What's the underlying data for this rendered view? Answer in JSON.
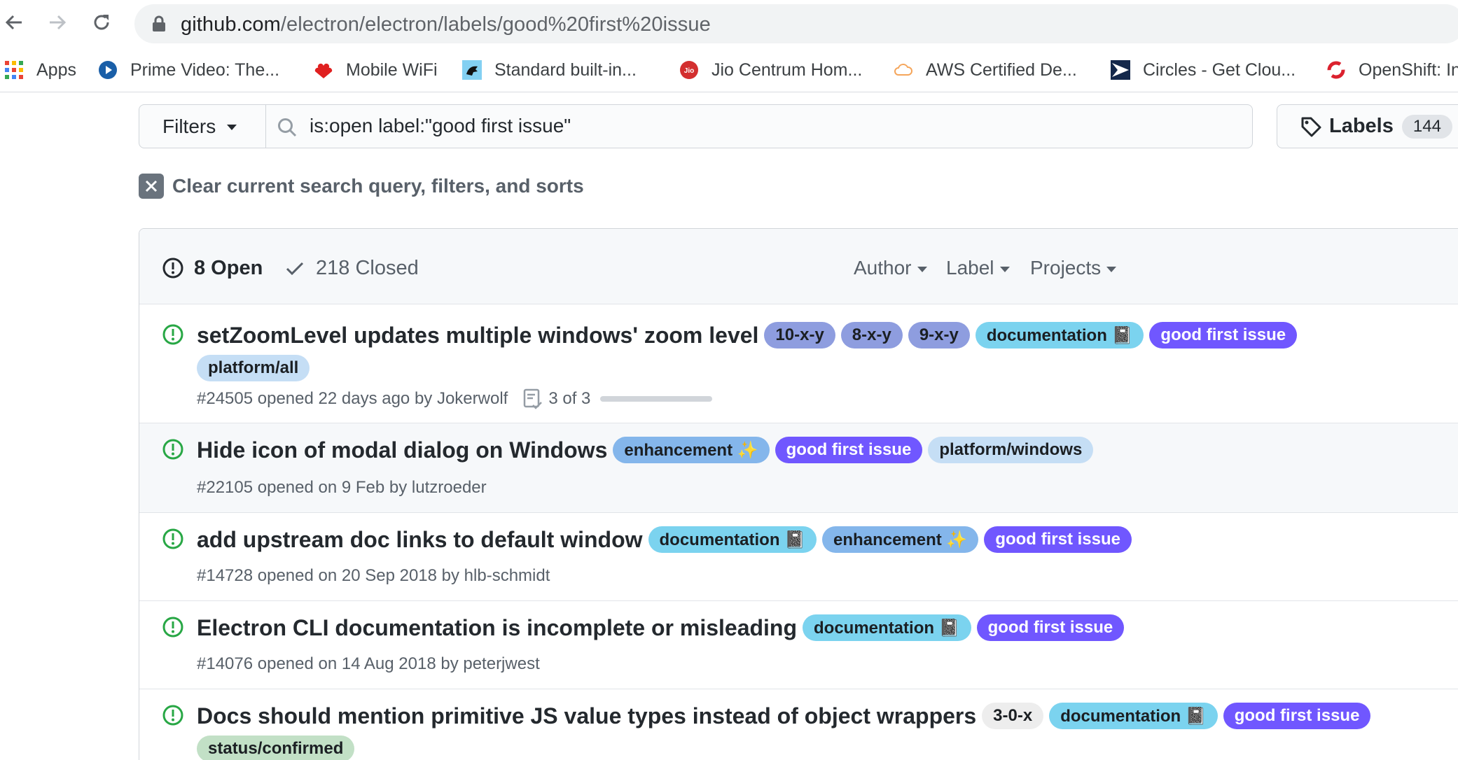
{
  "browser": {
    "url_host": "github.com",
    "url_path": "/electron/electron/labels/good%20first%20issue",
    "bookmarks": [
      {
        "label": "Apps",
        "icon": "apps-grid-icon"
      },
      {
        "label": "Prime Video: The...",
        "icon": "prime-video-icon"
      },
      {
        "label": "Mobile WiFi",
        "icon": "huawei-icon"
      },
      {
        "label": "Standard built-in...",
        "icon": "mdn-icon"
      },
      {
        "label": "Jio Centrum Hom...",
        "icon": "jio-icon"
      },
      {
        "label": "AWS Certified De...",
        "icon": "cloud-icon"
      },
      {
        "label": "Circles - Get Clou...",
        "icon": "circles-icon"
      },
      {
        "label": "OpenShift: In",
        "icon": "openshift-icon"
      }
    ]
  },
  "toolbar": {
    "filters_label": "Filters",
    "search_value": "is:open label:\"good first issue\"",
    "labels_label": "Labels",
    "labels_count": "144"
  },
  "clear_query_label": "Clear current search query, filters, and sorts",
  "header": {
    "open_label": "8 Open",
    "closed_label": "218 Closed",
    "filters": [
      "Author",
      "Label",
      "Projects"
    ]
  },
  "colors": {
    "open_green": "#28a745",
    "label_version": "#8e9ddf",
    "label_documentation": "#7bd3ef",
    "label_good_first_issue": "#7057ff",
    "label_platform": "#c5def5",
    "label_enhancement": "#84b6eb",
    "label_grey": "#ededed",
    "label_confirmed": "#c2e0c6"
  },
  "issues": [
    {
      "title": "setZoomLevel updates multiple windows' zoom level",
      "labels": [
        "10-x-y",
        "8-x-y",
        "9-x-y",
        "documentation 📓",
        "good first issue"
      ],
      "labels_wrap": [
        "platform/all"
      ],
      "meta": "#24505 opened 22 days ago by Jokerwolf",
      "tasks": "3 of 3",
      "tasks_progress": 1.0
    },
    {
      "title": "Hide icon of modal dialog on Windows",
      "labels": [
        "enhancement ✨",
        "good first issue",
        "platform/windows"
      ],
      "meta": "#22105 opened on 9 Feb by lutzroeder"
    },
    {
      "title": "add upstream doc links to default window",
      "labels": [
        "documentation 📓",
        "enhancement ✨",
        "good first issue"
      ],
      "meta": "#14728 opened on 20 Sep 2018 by hlb-schmidt"
    },
    {
      "title": "Electron CLI documentation is incomplete or misleading",
      "labels": [
        "documentation 📓",
        "good first issue"
      ],
      "meta": "#14076 opened on 14 Aug 2018 by peterjwest"
    },
    {
      "title": "Docs should mention primitive JS value types instead of object wrappers",
      "labels": [
        "3-0-x",
        "documentation 📓",
        "good first issue"
      ],
      "labels_wrap": [
        "status/confirmed"
      ]
    }
  ]
}
